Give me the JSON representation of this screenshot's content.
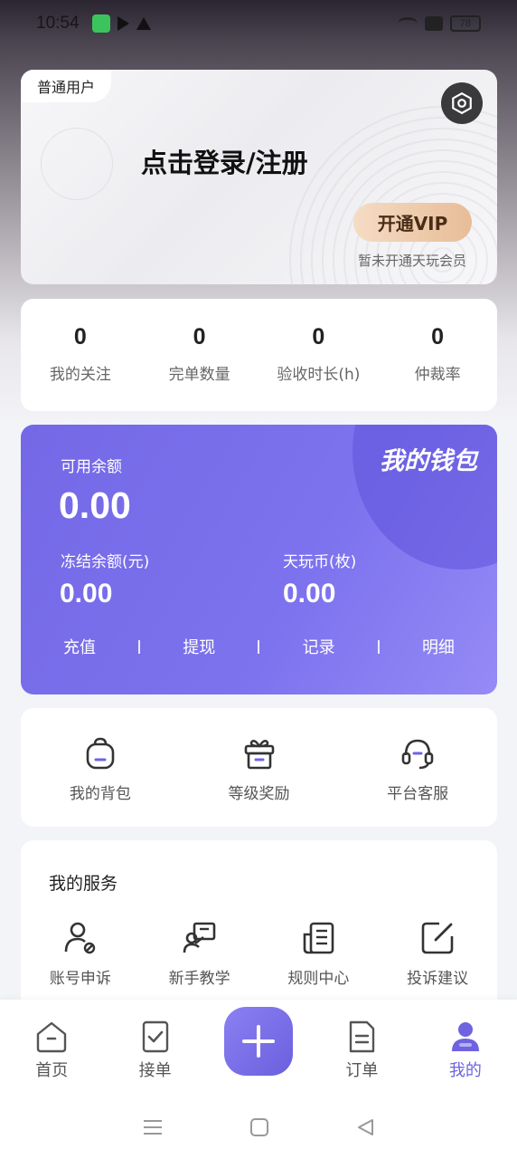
{
  "status_bar": {
    "time": "10:54",
    "battery": "78"
  },
  "profile": {
    "user_type": "普通用户",
    "login_prompt": "点击登录/注册",
    "vip_button": "开通VIP",
    "vip_note": "暂未开通天玩会员"
  },
  "stats": [
    {
      "value": "0",
      "label": "我的关注"
    },
    {
      "value": "0",
      "label": "完单数量"
    },
    {
      "value": "0",
      "label": "验收时长(h)"
    },
    {
      "value": "0",
      "label": "仲裁率"
    }
  ],
  "wallet": {
    "title": "我的钱包",
    "available_label": "可用余额",
    "available_value": "0.00",
    "frozen_label": "冻结余额(元)",
    "frozen_value": "0.00",
    "coin_label": "天玩币(枚)",
    "coin_value": "0.00",
    "actions": [
      "充值",
      "提现",
      "记录",
      "明细"
    ]
  },
  "quick": [
    {
      "label": "我的背包",
      "icon": "backpack-icon"
    },
    {
      "label": "等级奖励",
      "icon": "gift-icon"
    },
    {
      "label": "平台客服",
      "icon": "headset-icon"
    }
  ],
  "services": {
    "title": "我的服务",
    "items": [
      {
        "label": "账号申诉",
        "icon": "user-appeal-icon"
      },
      {
        "label": "新手教学",
        "icon": "teacher-icon"
      },
      {
        "label": "规则中心",
        "icon": "document-icon"
      },
      {
        "label": "投诉建议",
        "icon": "edit-icon"
      }
    ]
  },
  "bottom_nav": {
    "items": [
      {
        "label": "首页",
        "icon": "home-icon"
      },
      {
        "label": "接单",
        "icon": "order-check-icon"
      },
      {
        "label": "订单",
        "icon": "list-icon"
      },
      {
        "label": "我的",
        "icon": "profile-icon"
      }
    ]
  },
  "colors": {
    "accent": "#6e63e0",
    "vip_gold": "#e7bd98"
  }
}
